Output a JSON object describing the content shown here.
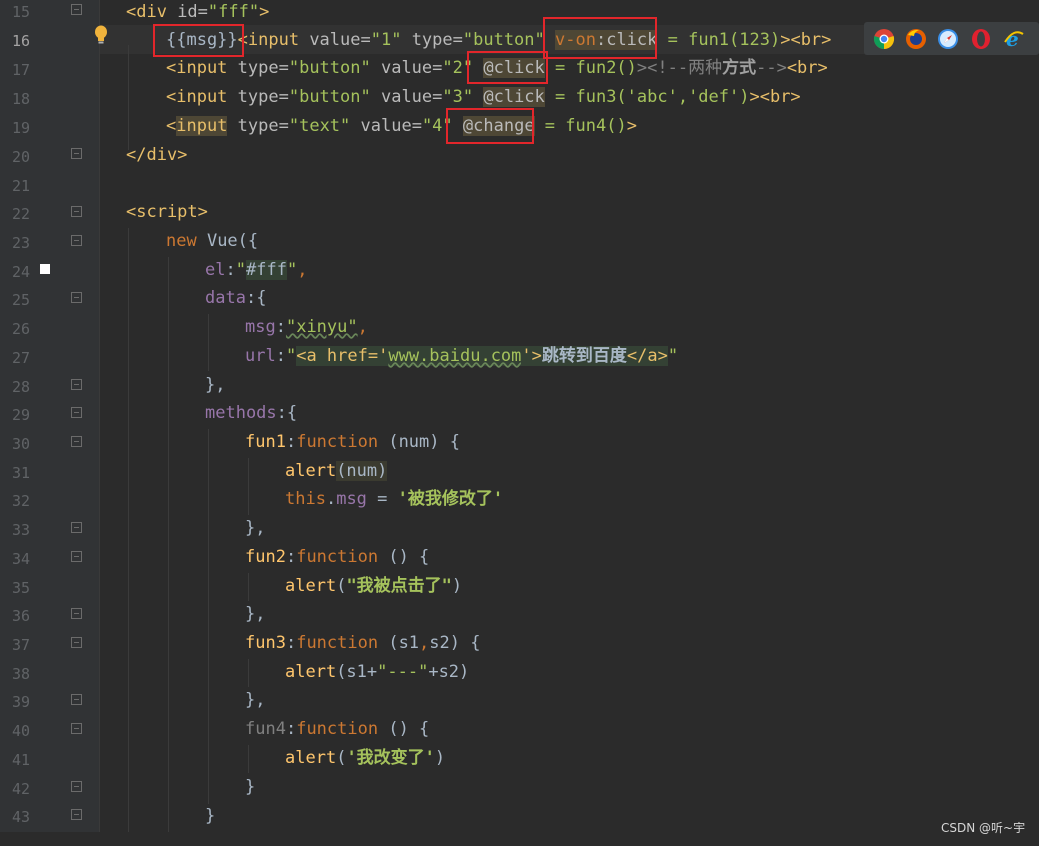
{
  "editor": {
    "lines": [
      {
        "num": "15"
      },
      {
        "num": "16"
      },
      {
        "num": "17"
      },
      {
        "num": "18"
      },
      {
        "num": "19"
      },
      {
        "num": "20"
      },
      {
        "num": "21"
      },
      {
        "num": "22"
      },
      {
        "num": "23"
      },
      {
        "num": "24"
      },
      {
        "num": "25"
      },
      {
        "num": "26"
      },
      {
        "num": "27"
      },
      {
        "num": "28"
      },
      {
        "num": "29"
      },
      {
        "num": "30"
      },
      {
        "num": "31"
      },
      {
        "num": "32"
      },
      {
        "num": "33"
      },
      {
        "num": "34"
      },
      {
        "num": "35"
      },
      {
        "num": "36"
      },
      {
        "num": "37"
      },
      {
        "num": "38"
      },
      {
        "num": "39"
      },
      {
        "num": "40"
      },
      {
        "num": "41"
      },
      {
        "num": "42"
      },
      {
        "num": "43"
      }
    ],
    "code": {
      "l15": {
        "a": "<div",
        "b": " id=",
        "c": "\"fff\"",
        "d": ">"
      },
      "l16": {
        "a": "{{msg}}",
        "b": "<input",
        "c": " value=",
        "d": "\"1\"",
        "e": " type=",
        "f": "\"button\"",
        "g": " ",
        "h": "v-on",
        "i": ":click",
        "j": " = fun1(123)",
        "k": "><br>"
      },
      "l17": {
        "a": "<input",
        "b": " type=",
        "c": "\"button\"",
        "d": " value=",
        "e": "\"2\"",
        "f": " ",
        "g": "@click",
        "h": " = fun2()",
        "i": "><!--",
        "j": "两种",
        "k": "方式",
        "l": "-->",
        "m": "<br>"
      },
      "l18": {
        "a": "<input",
        "b": " type=",
        "c": "\"button\"",
        "d": " value=",
        "e": "\"3\"",
        "f": " ",
        "g": "@click",
        "h": " = fun3('abc','def')",
        "i": "><br>"
      },
      "l19": {
        "a": "<",
        "b": "input",
        "c": " type=",
        "d": "\"text\"",
        "e": " value=",
        "f": "\"4\"",
        "g": " ",
        "h": "@change",
        "i": " = fun4()",
        "j": ">"
      },
      "l20": {
        "a": "</div>"
      },
      "l22": {
        "a": "<script>"
      },
      "l23": {
        "a": "new",
        "b": " Vue({"
      },
      "l24": {
        "a": "el",
        "b": ":",
        "c": "\"",
        "d": "#fff",
        "e": "\"",
        "f": ","
      },
      "l25": {
        "a": "data",
        "b": ":{"
      },
      "l26": {
        "a": "msg",
        "b": ":",
        "c": "\"xinyu\"",
        "d": ","
      },
      "l27": {
        "a": "url",
        "b": ":",
        "c": "\"",
        "d": "<a href='",
        "e": "www.baidu.com",
        "f": "'>",
        "g": "跳转到百度",
        "h": "</a>",
        "i": "\""
      },
      "l28": {
        "a": "},"
      },
      "l29": {
        "a": "methods",
        "b": ":{"
      },
      "l30": {
        "a": "fun1",
        "b": ":",
        "c": "function",
        "d": " (num) {"
      },
      "l31": {
        "a": "alert",
        "b": "(num)"
      },
      "l32": {
        "a": "this",
        "b": ".",
        "c": "msg",
        "d": " = ",
        "e": "'被我修改了'"
      },
      "l33": {
        "a": "},"
      },
      "l34": {
        "a": "fun2",
        "b": ":",
        "c": "function",
        "d": " () {"
      },
      "l35": {
        "a": "alert",
        "b": "(",
        "c": "\"我被点击了\"",
        "d": ")"
      },
      "l36": {
        "a": "},"
      },
      "l37": {
        "a": "fun3",
        "b": ":",
        "c": "function",
        "d": " (s1",
        "e": ",",
        "f": "s2) {"
      },
      "l38": {
        "a": "alert",
        "b": "(s1+",
        "c": "\"---\"",
        "d": "+s2)"
      },
      "l39": {
        "a": "},"
      },
      "l40": {
        "a": "fun4",
        "b": ":",
        "c": "function",
        "d": " () {"
      },
      "l41": {
        "a": "alert",
        "b": "(",
        "c": "'我改变了'",
        "d": ")"
      },
      "l42": {
        "a": "}"
      },
      "l43": {
        "a": "}"
      }
    }
  },
  "browser_icons": [
    "chrome-icon",
    "firefox-icon",
    "safari-icon",
    "opera-icon",
    "ie-icon"
  ],
  "watermark": "CSDN @听~宇",
  "colors": {
    "highlight_box": "#e2262b",
    "background": "#2b2b2b"
  }
}
